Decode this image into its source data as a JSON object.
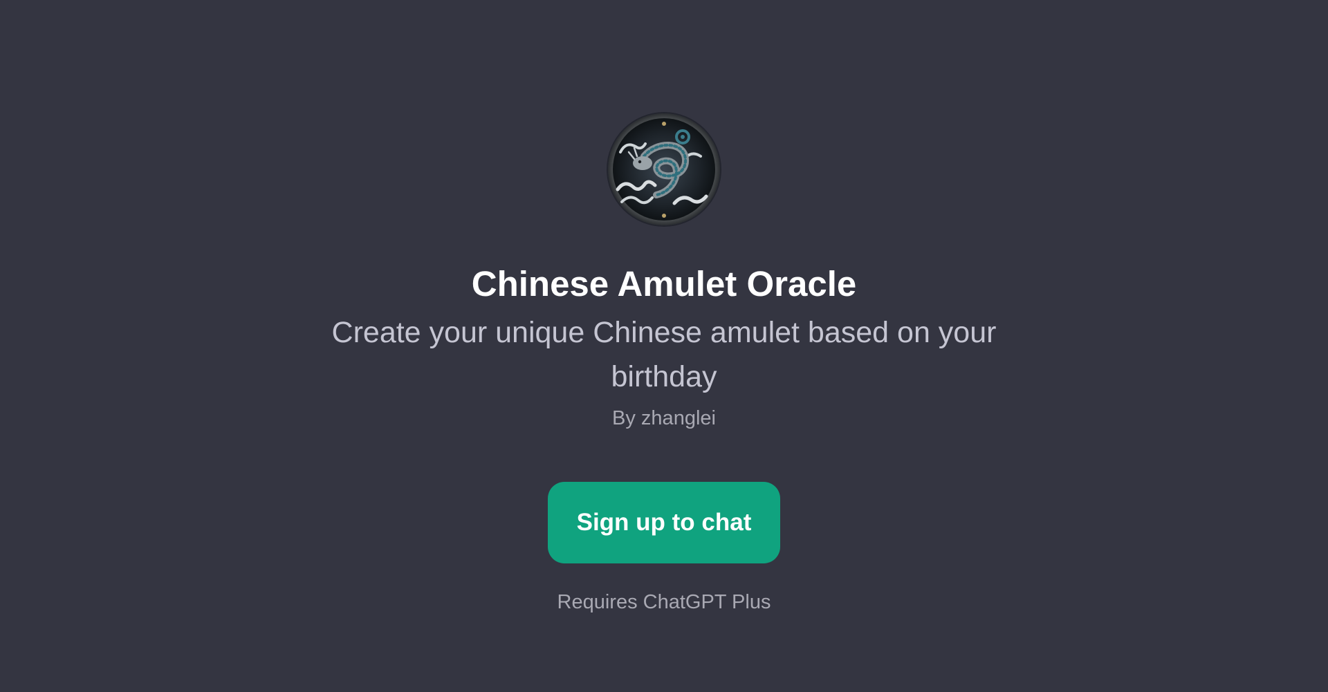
{
  "gpt": {
    "avatar_icon": "dragon-amulet-icon",
    "title": "Chinese Amulet Oracle",
    "description": "Create your unique Chinese amulet based on your birthday",
    "author": "By zhanglei"
  },
  "actions": {
    "signup_label": "Sign up to chat"
  },
  "footer": {
    "requirement": "Requires ChatGPT Plus"
  },
  "colors": {
    "background": "#343541",
    "button": "#10a37f",
    "title": "#ffffff",
    "description": "#c5c5d2",
    "muted": "#a9a9b3"
  }
}
